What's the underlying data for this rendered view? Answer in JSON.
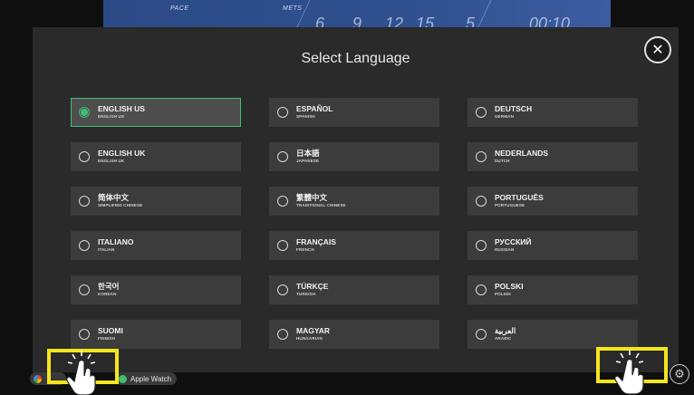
{
  "background": {
    "labels": [
      "PACE",
      "METS"
    ],
    "values": [
      "6",
      "9",
      "12",
      "15",
      "5",
      "00:10"
    ]
  },
  "modal": {
    "title": "Select Language",
    "close_icon": "close-icon"
  },
  "languages": [
    {
      "name": "ENGLISH US",
      "sub": "ENGLISH US",
      "selected": true
    },
    {
      "name": "ESPAÑOL",
      "sub": "SPANISH",
      "selected": false
    },
    {
      "name": "DEUTSCH",
      "sub": "GERMAN",
      "selected": false
    },
    {
      "name": "ENGLISH UK",
      "sub": "ENGLISH UK",
      "selected": false
    },
    {
      "name": "日本語",
      "sub": "JAPANESE",
      "selected": false
    },
    {
      "name": "NEDERLANDS",
      "sub": "DUTCH",
      "selected": false
    },
    {
      "name": "简体中文",
      "sub": "SIMPLIFIED CHINESE",
      "selected": false
    },
    {
      "name": "繁體中文",
      "sub": "TRADITIONAL CHINESE",
      "selected": false
    },
    {
      "name": "PORTUGUÊS",
      "sub": "PORTUGUESE",
      "selected": false
    },
    {
      "name": "ITALIANO",
      "sub": "ITALIAN",
      "selected": false
    },
    {
      "name": "FRANÇAIS",
      "sub": "FRENCH",
      "selected": false
    },
    {
      "name": "РУССКИЙ",
      "sub": "RUSSIAN",
      "selected": false
    },
    {
      "name": "한국어",
      "sub": "KOREAN",
      "selected": false
    },
    {
      "name": "TÜRKÇE",
      "sub": "TURKISH",
      "selected": false
    },
    {
      "name": "POLSKI",
      "sub": "POLISH",
      "selected": false
    },
    {
      "name": "SUOMI",
      "sub": "FINNISH",
      "selected": false
    },
    {
      "name": "MAGYAR",
      "sub": "HUNGARIAN",
      "selected": false
    },
    {
      "name": "العربية",
      "sub": "ARABIC",
      "selected": false
    }
  ],
  "footer": {
    "apple_watch_label": "Apple Watch",
    "settings_icon": "gear-icon"
  },
  "colors": {
    "accent": "#3fbf73",
    "highlight": "#f4e51c"
  }
}
